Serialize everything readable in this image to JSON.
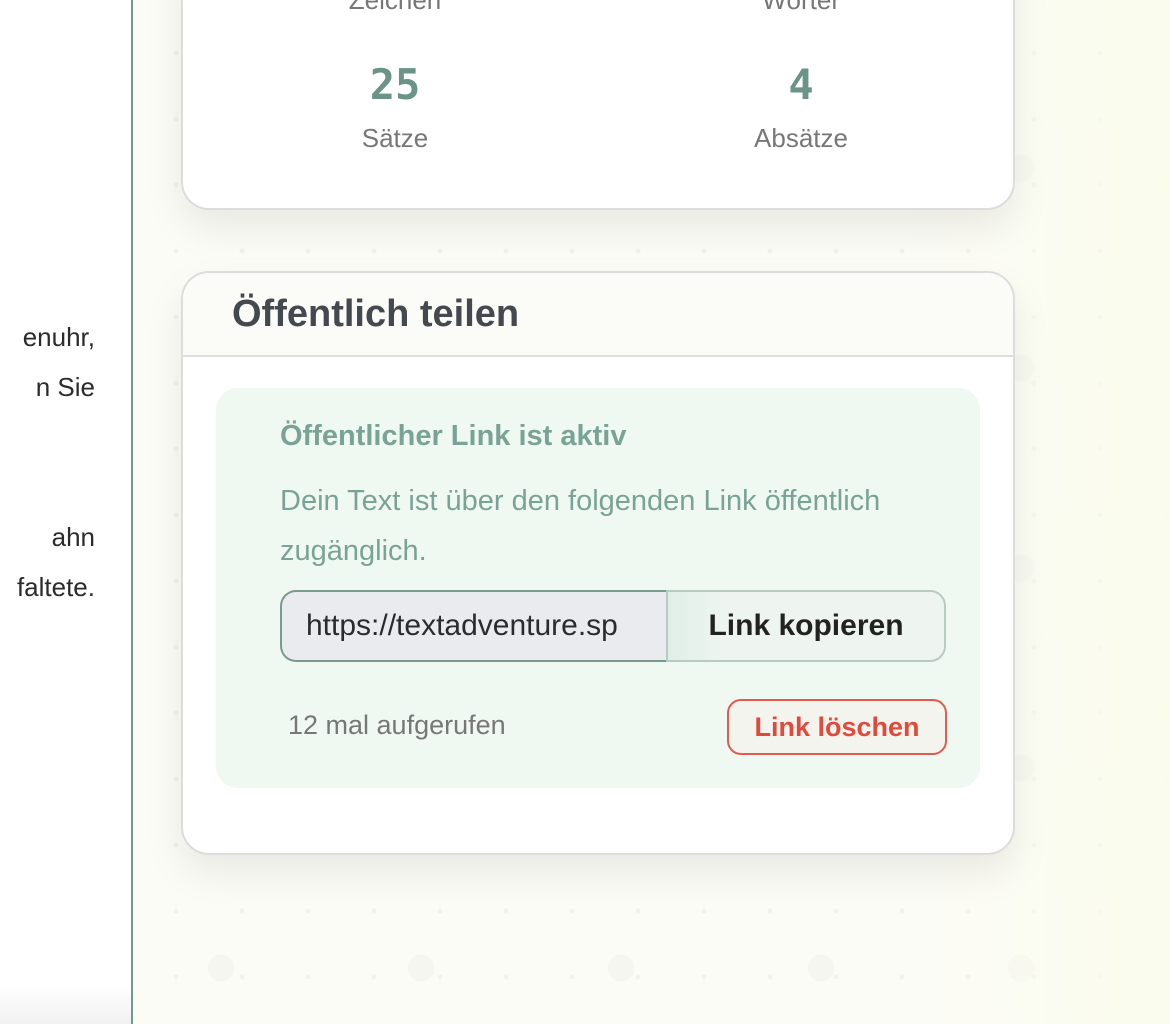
{
  "editor": {
    "lines": [
      "enuhr,",
      "n Sie",
      "ahn",
      "faltete."
    ]
  },
  "stats": {
    "top_labels": [
      "Zeichen",
      "Wörter"
    ],
    "sentences_value": "25",
    "sentences_label": "Sätze",
    "paragraphs_value": "4",
    "paragraphs_label": "Absätze"
  },
  "share": {
    "title": "Öffentlich teilen",
    "active_title": "Öffentlicher Link ist aktiv",
    "active_description": "Dein Text ist über den folgenden Link öffentlich zugänglich.",
    "link_value": "https://textadventure.sp",
    "copy_label": "Link kopieren",
    "views_text": "12 mal aufgerufen",
    "delete_label": "Link löschen"
  },
  "colors": {
    "accent": "#6b9488",
    "success_bg": "#eff8f1",
    "danger": "#e04a3c",
    "divider": "#6f9a8d"
  }
}
